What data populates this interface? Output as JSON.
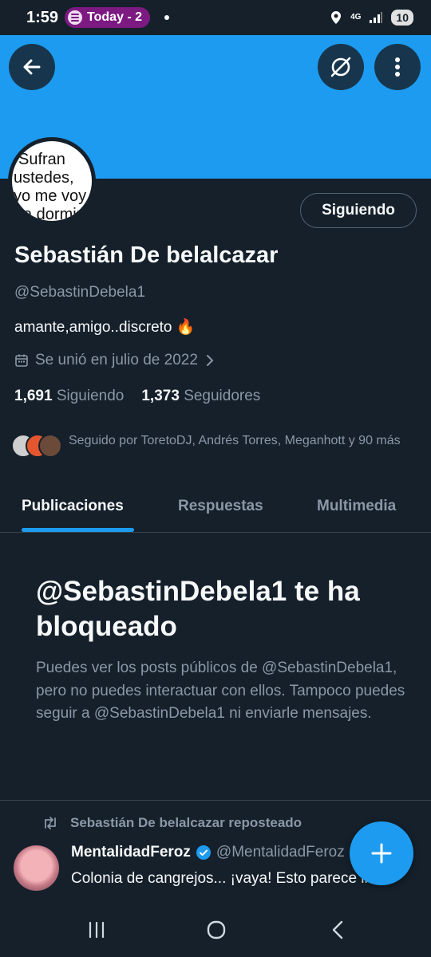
{
  "status_bar": {
    "time": "1:59",
    "media_label": "Today - 2",
    "network": "4G",
    "battery": "10"
  },
  "profile": {
    "avatar_lines": [
      "Sufran",
      "ustedes,",
      "yo me voy",
      "a dormir"
    ],
    "following_button": "Siguiendo",
    "name": "Sebastián De belalcazar",
    "handle": "@SebastinDebela1",
    "bio": "amante,amigo..discreto 🔥",
    "joined": "Se unió en julio de 2022",
    "following_count": "1,691",
    "following_label": "Siguiendo",
    "followers_count": "1,373",
    "followers_label": "Seguidores",
    "followed_by": "Seguido por ToretoDJ, Andrés Torres, Meganhott y 90 más"
  },
  "tabs": [
    {
      "label": "Publicaciones",
      "active": true
    },
    {
      "label": "Respuestas",
      "active": false
    },
    {
      "label": "Multimedia",
      "active": false
    }
  ],
  "blocked": {
    "title": "@SebastinDebela1 te ha bloqueado",
    "description": "Puedes ver los posts públicos de @SebastinDebela1, pero no puedes interactuar con ellos. Tampoco puedes seguir a @SebastinDebela1 ni enviarle mensajes."
  },
  "post": {
    "repost_label": "Sebastián De belalcazar reposteado",
    "author_name": "MentalidadFeroz",
    "author_handle": "@MentalidadFeroz",
    "text": "Colonia de cangrejos... ¡vaya! Esto parece irreal"
  },
  "colors": {
    "background": "#15202b",
    "accent": "#1d9bf0",
    "muted_text": "#8b98a5",
    "spotify_pill": "#7c1a82"
  },
  "icons": [
    "back-arrow-icon",
    "unfollow-icon",
    "more-vertical-icon",
    "calendar-icon",
    "chevron-right-icon",
    "repost-icon",
    "verified-badge-icon",
    "plus-icon",
    "recents-icon",
    "home-icon",
    "back-nav-icon"
  ]
}
